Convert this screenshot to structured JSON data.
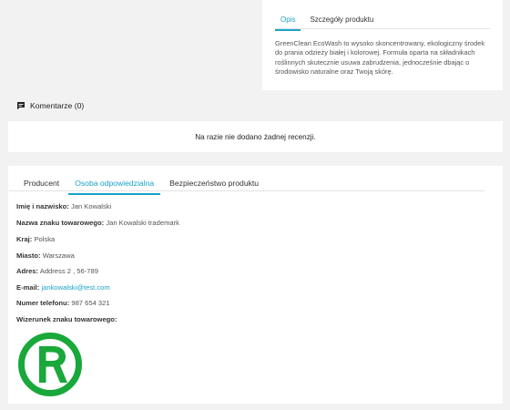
{
  "description": {
    "tabs": [
      "Opis",
      "Szczegóły produktu"
    ],
    "active_tab": "Opis",
    "text": "GreenClean EcoWash to wysoko skoncentrowany, ekologiczny środek do prania odzieży białej i kolorowej. Formuła oparta na składnikach roślinnych skutecznie usuwa zabrudzenia, jednocześnie dbając o środowisko naturalne oraz Twoją skórę."
  },
  "comments": {
    "heading": "Komentarze (0)",
    "icon": "comment-icon",
    "empty_message": "Na razie nie dodano żadnej recenzji."
  },
  "info_tabs": {
    "tabs": [
      "Producent",
      "Osoba odpowiedzialna",
      "Bezpieczeństwo produktu"
    ],
    "active_tab": "Osoba odpowiedzialna"
  },
  "responsible_person": {
    "name_label": "Imię i nazwisko:",
    "name_value": "Jan Kowalski",
    "trademark_label": "Nazwa znaku towarowego:",
    "trademark_value": "Jan Kowalski trademark",
    "country_label": "Kraj:",
    "country_value": "Polska",
    "city_label": "Miasto:",
    "city_value": "Warszawa",
    "address_label": "Adres:",
    "address_value": "Address 2 , 56-789",
    "email_label": "E-mail:",
    "email_value": "jankowalski@test.com",
    "phone_label": "Numer telefonu:",
    "phone_value": "987 654 321",
    "image_label": "Wizerunek znaku towarowego:",
    "image_icon": "registered-trademark-icon"
  },
  "colors": {
    "accent": "#1aa3c8",
    "logo_green": "#19a83a",
    "background": "#f2f2f2"
  }
}
